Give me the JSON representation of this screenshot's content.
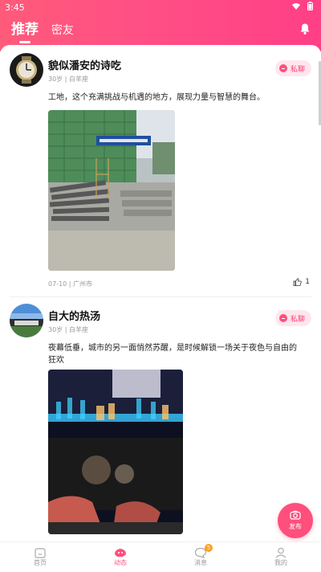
{
  "status": {
    "time": "3:45"
  },
  "tabs": [
    {
      "label": "推荐",
      "active": true
    },
    {
      "label": "密友",
      "active": false
    }
  ],
  "posts": [
    {
      "username": "貌似潘安的诗吃",
      "age": "30岁",
      "zodiac": "白羊座",
      "dm_label": "私聊",
      "content": "工地，这个充满挑战与机遇的地方，展现力量与智慧的舞台。",
      "date": "07-10",
      "location": "广州市",
      "likes": "1"
    },
    {
      "username": "自大的热汤",
      "age": "30岁",
      "zodiac": "白羊座",
      "dm_label": "私聊",
      "content_line1": "夜幕低垂，城市的另一面悄然苏醒，是时候解锁一场关于夜色与自由的",
      "content_line2": "狂欢"
    }
  ],
  "fab": {
    "label": "发布"
  },
  "nav": [
    {
      "label": "首页",
      "active": false
    },
    {
      "label": "动态",
      "active": true
    },
    {
      "label": "消息",
      "active": false,
      "badge": "5"
    },
    {
      "label": "我的",
      "active": false
    }
  ],
  "colors": {
    "accent": "#ff4f7c",
    "header_start": "#ff5a7a",
    "header_end": "#ff3f86",
    "badge": "#ff9f1a"
  }
}
